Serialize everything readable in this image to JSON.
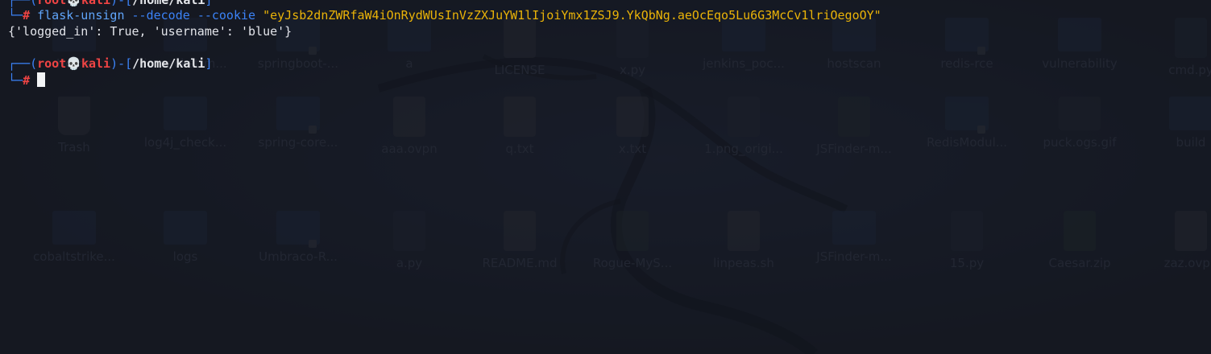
{
  "terminal": {
    "prev_prompt": {
      "root": "root",
      "host": "kali",
      "path": "/home/kali"
    },
    "command": {
      "prefix": "#",
      "program": "flask-unsign",
      "flag1": "--decode",
      "flag2": "--cookie",
      "value": "\"eyJsb2dnZWRfaW4iOnRydWUsInVzZXJuYW1lIjoiYmx1ZSJ9.YkQbNg.aeOcEqo5Lu6G3McCv1lriOegoOY\""
    },
    "output": "{'logged_in': True, 'username': 'blue'}",
    "prompt": {
      "root": "root",
      "skull": "💀",
      "host": "kali",
      "path": "/home/kali",
      "prefix": "#"
    }
  },
  "desktop": {
    "row1": [
      {
        "label": "Home",
        "icon": "folder-icon"
      },
      {
        "label": "impacket-m...",
        "icon": "folder-icon"
      },
      {
        "label": "springboot-...",
        "icon": "folder-icon"
      },
      {
        "label": "a",
        "icon": "folder-icon"
      },
      {
        "label": "LICENSE",
        "icon": "file-icon"
      },
      {
        "label": "x.py",
        "icon": "python-file-icon"
      },
      {
        "label": "jenkins_poc...",
        "icon": "folder-icon"
      },
      {
        "label": "hostscan",
        "icon": "folder-icon"
      },
      {
        "label": "redis-rce",
        "icon": "folder-icon"
      },
      {
        "label": "vulnerability",
        "icon": "folder-icon"
      },
      {
        "label": "cmd.py",
        "icon": "python-file-icon"
      }
    ],
    "row2": [
      {
        "label": "Trash",
        "icon": "trash-icon"
      },
      {
        "label": "log4j_check...",
        "icon": "folder-icon"
      },
      {
        "label": "spring-core...",
        "icon": "folder-icon"
      },
      {
        "label": "aaa.ovpn",
        "icon": "file-icon"
      },
      {
        "label": "q.txt",
        "icon": "file-icon"
      },
      {
        "label": "x.txt",
        "icon": "file-icon"
      },
      {
        "label": "1.png_origi...",
        "icon": "tux-icon"
      },
      {
        "label": "JSFinder-m...",
        "icon": "zip-icon"
      },
      {
        "label": "RedisModul...",
        "icon": "folder-icon"
      },
      {
        "label": "puck.ogs.gif",
        "icon": "executable-icon"
      },
      {
        "label": "build",
        "icon": "folder-icon"
      }
    ],
    "row3": [
      {
        "label": "cobaltstrike...",
        "icon": "folder-icon"
      },
      {
        "label": "logs",
        "icon": "folder-icon"
      },
      {
        "label": "Umbraco-R...",
        "icon": "folder-icon"
      },
      {
        "label": "a.py",
        "icon": "python-file-icon"
      },
      {
        "label": "README.md",
        "icon": "file-icon"
      },
      {
        "label": "Rogue-MyS...",
        "icon": "zip-icon"
      },
      {
        "label": "linpeas.sh",
        "icon": "script-icon"
      },
      {
        "label": "JSFinder-m...",
        "icon": "folder-icon"
      },
      {
        "label": "15.py",
        "icon": "python-file-icon"
      },
      {
        "label": "Caesar.zip",
        "icon": "zip-icon"
      },
      {
        "label": "zaz.ovpn",
        "icon": "file-icon"
      }
    ]
  }
}
